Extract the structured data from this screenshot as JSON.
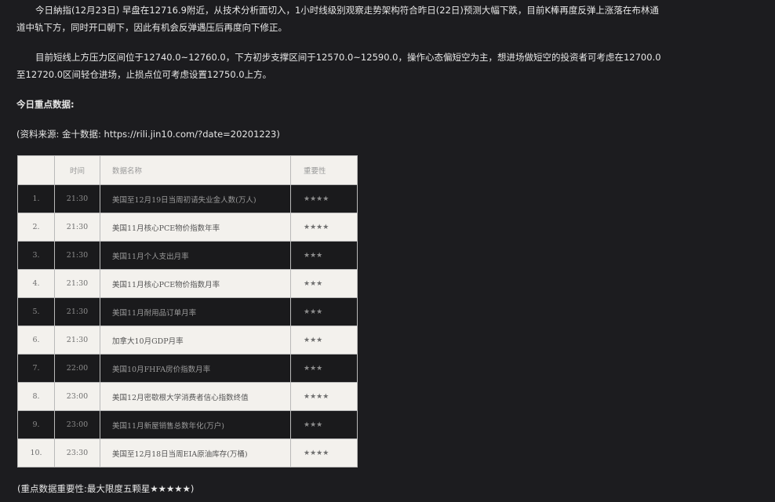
{
  "paragraphs": [
    "今日納指(12月23日) 早盘在12716.9附近，从技术分析面切入，1小时线级别观察走势架构符合昨日(22日)预测大幅下跌，目前K棒再度反弹上涨落在布林通道中轨下方，同时开口朝下，因此有机会反弹遇压后再度向下修正。",
    "目前短线上方压力区间位于12740.0~12760.0，下方初步支撑区间于12570.0~12590.0，操作心态偏短空为主，想进场做短空的投资者可考虑在12700.0至12720.0区间轻仓进场，止损点位可考虑设置12750.0上方。"
  ],
  "heading": "今日重点数据:",
  "source": "(资料来源: 金十数据: https://rili.jin10.com/?date=20201223)",
  "table": {
    "headers": [
      "",
      "时间",
      "数据名称",
      "重要性"
    ],
    "rows": [
      {
        "no": "1.",
        "time": "21:30",
        "name": "美国至12月19日当周初请失业金人数(万人)",
        "importance": "★★★★"
      },
      {
        "no": "2.",
        "time": "21:30",
        "name": "美国11月核心PCE物价指数年率",
        "importance": "★★★★"
      },
      {
        "no": "3.",
        "time": "21:30",
        "name": "美国11月个人支出月率",
        "importance": "★★★"
      },
      {
        "no": "4.",
        "time": "21:30",
        "name": "美国11月核心PCE物价指数月率",
        "importance": "★★★"
      },
      {
        "no": "5.",
        "time": "21:30",
        "name": "美国11月耐用品订单月率",
        "importance": "★★★"
      },
      {
        "no": "6.",
        "time": "21:30",
        "name": "加拿大10月GDP月率",
        "importance": "★★★"
      },
      {
        "no": "7.",
        "time": "22:00",
        "name": "美国10月FHFA房价指数月率",
        "importance": "★★★"
      },
      {
        "no": "8.",
        "time": "23:00",
        "name": "美国12月密歇根大学消费者信心指数终值",
        "importance": "★★★★"
      },
      {
        "no": "9.",
        "time": "23:00",
        "name": "美国11月新屋销售总数年化(万户)",
        "importance": "★★★"
      },
      {
        "no": "10.",
        "time": "23:30",
        "name": "美国至12月18日当周EIA原油库存(万桶)",
        "importance": "★★★★"
      }
    ]
  },
  "footer": "(重点数据重要性:最大限度五颗星★★★★★)"
}
